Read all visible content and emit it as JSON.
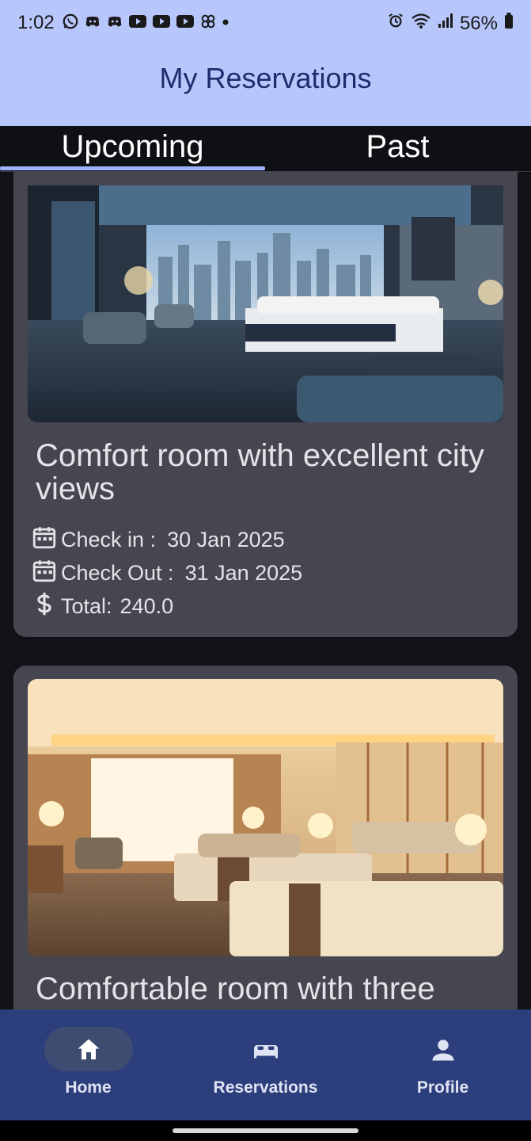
{
  "status_bar": {
    "time": "1:02",
    "battery": "56%",
    "notification_icons": [
      "whatsapp-icon",
      "discord-icon",
      "discord-icon",
      "youtube-icon",
      "youtube-icon",
      "youtube-icon",
      "pinwheel-icon",
      "dot-icon"
    ],
    "right_icons": [
      "alarm-icon",
      "wifi-icon",
      "signal-icon",
      "battery-icon"
    ]
  },
  "app_bar": {
    "title": "My Reservations"
  },
  "tabs": [
    {
      "label": "Upcoming",
      "selected": true
    },
    {
      "label": "Past",
      "selected": false
    }
  ],
  "reservations": [
    {
      "title": "Comfort room with excellent city views",
      "check_in_label": "Check in :",
      "check_in": "30 Jan 2025",
      "check_out_label": "Check Out :",
      "check_out": "31 Jan 2025",
      "total_label": "Total:",
      "total": "240.0"
    },
    {
      "title": "Comfortable room with three"
    }
  ],
  "bottom_nav": [
    {
      "label": "Home",
      "icon": "home-icon",
      "active": true
    },
    {
      "label": "Reservations",
      "icon": "bed-icon",
      "active": false
    },
    {
      "label": "Profile",
      "icon": "person-icon",
      "active": false
    }
  ],
  "colors": {
    "app_bar": "#b7c6fb",
    "background": "#111218",
    "card": "#45464f",
    "tab_indicator": "#9fb3ff",
    "bottom_nav": "#2c3f7c"
  }
}
